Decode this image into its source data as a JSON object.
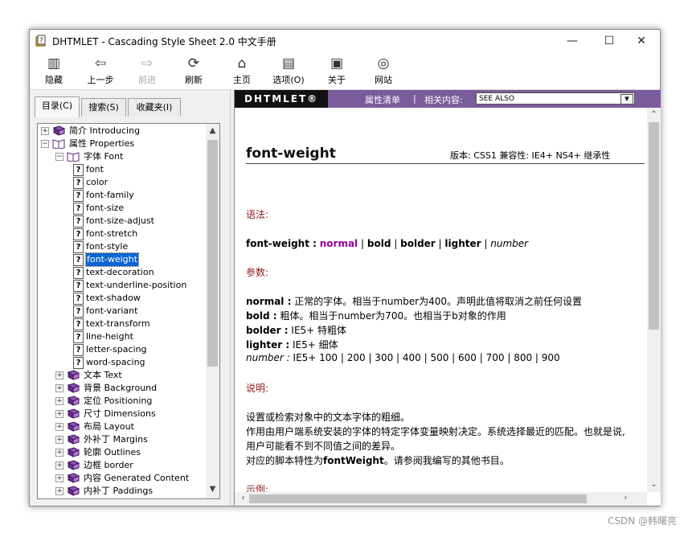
{
  "window": {
    "title": "DHTMLET - Cascading Style Sheet 2.0 中文手册",
    "controls": {
      "minimize": "—",
      "maximize": "☐",
      "close": "✕"
    }
  },
  "toolbar": {
    "buttons": [
      {
        "label": "隐藏",
        "icon": "hide-icon",
        "glyph": "▥",
        "enabled": true
      },
      {
        "label": "上一步",
        "icon": "back-arrow-icon",
        "glyph": "⇦",
        "enabled": true
      },
      {
        "label": "前进",
        "icon": "forward-arrow-icon",
        "glyph": "⇨",
        "enabled": false
      },
      {
        "label": "刷新",
        "icon": "refresh-icon",
        "glyph": "⟳",
        "enabled": true
      },
      {
        "label": "主页",
        "icon": "home-icon",
        "glyph": "⌂",
        "enabled": true
      },
      {
        "label": "选项(O)",
        "icon": "options-icon",
        "glyph": "▤",
        "enabled": true
      },
      {
        "label": "关于",
        "icon": "about-icon",
        "glyph": "▣",
        "enabled": true
      },
      {
        "label": "网站",
        "icon": "globe-icon",
        "glyph": "◎",
        "enabled": true
      }
    ]
  },
  "tabs": [
    {
      "label": "目录(C)",
      "active": true
    },
    {
      "label": "搜索(S)",
      "active": false
    },
    {
      "label": "收藏夹(I)",
      "active": false
    }
  ],
  "tree": {
    "top": [
      {
        "label": "简介  Introducing",
        "expanded": false
      },
      {
        "label": "属性  Properties",
        "expanded": true
      }
    ],
    "font_node": {
      "label": "字体  Font"
    },
    "font_items": [
      "font",
      "color",
      "font-family",
      "font-size",
      "font-size-adjust",
      "font-stretch",
      "font-style",
      "font-weight",
      "text-decoration",
      "text-underline-position",
      "text-shadow",
      "font-variant",
      "text-transform",
      "line-height",
      "letter-spacing",
      "word-spacing"
    ],
    "selected": "font-weight",
    "sections": [
      "文本  Text",
      "背景  Background",
      "定位  Positioning",
      "尺寸  Dimensions",
      "布局  Layout",
      "外补丁  Margins",
      "轮廓  Outlines",
      "边框  border",
      "内容  Generated Content",
      "内补丁  Paddings"
    ]
  },
  "banner": {
    "brand": "DHTMLET®",
    "list_link": "属性清单",
    "separator": "|",
    "related_label": "相关内容:",
    "dropdown_value": "SEE ALSO"
  },
  "page": {
    "title": "font-weight",
    "version_info": "版本: CSS1    兼容性: IE4+ NS4+    继承性",
    "syntax_heading": "语法:",
    "syntax": {
      "name": "font-weight :",
      "normal": "normal",
      "bold": "bold",
      "bolder": "bolder",
      "lighter": "lighter",
      "number": "number",
      "sep": "|"
    },
    "params_heading": "参数:",
    "params": [
      {
        "name": "normal :",
        "desc": "正常的字体。相当于number为400。声明此值将取消之前任何设置",
        "italic": false
      },
      {
        "name": "bold :",
        "desc": "粗体。相当于number为700。也相当于b对象的作用",
        "italic": false
      },
      {
        "name": "bolder :",
        "desc": "IE5+   特粗体",
        "italic": false
      },
      {
        "name": "lighter :",
        "desc": "IE5+   细体",
        "italic": false
      },
      {
        "name": "number :",
        "desc": "IE5+   100 | 200 | 300 | 400 | 500 | 600 | 700 | 800 | 900",
        "italic": true
      }
    ],
    "desc_heading": "说明:",
    "desc_lines": [
      "设置或检索对象中的文本字体的粗细。",
      "作用由用户端系统安装的字体的特定字体变量映射决定。系统选择最近的匹配。也就是说,",
      "用户可能看不到不同值之间的差异。"
    ],
    "script_prefix": "对应的脚本特性为",
    "script_prop": "fontWeight",
    "script_suffix": "。请参阅我编写的其他书目。",
    "example_heading": "示例:"
  },
  "watermark": "CSDN @韩曙亮"
}
